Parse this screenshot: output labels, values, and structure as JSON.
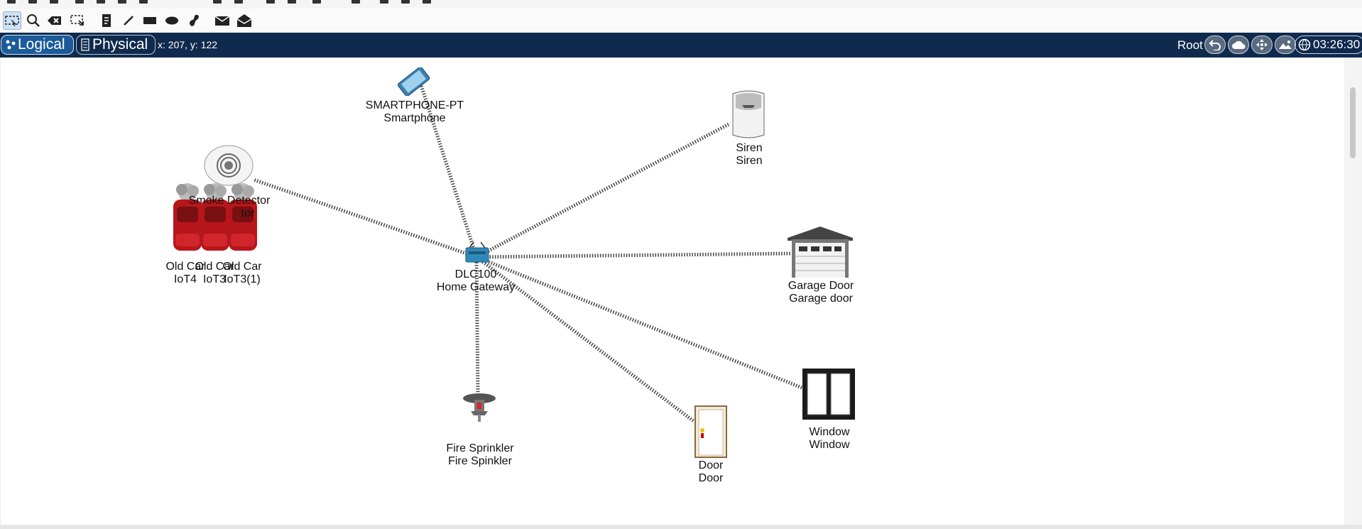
{
  "toolbar": {
    "tools": [
      "select-icon",
      "zoom-icon",
      "delete-icon",
      "resize-icon",
      "note-icon",
      "line-icon",
      "rectangle-icon",
      "ellipse-icon",
      "freeform-icon",
      "simple-pdu-icon",
      "complex-pdu-icon"
    ]
  },
  "navbar": {
    "tab_logical": "Logical",
    "tab_physical": "Physical",
    "coordinates": "x: 207, y: 122",
    "root_label": "Root",
    "time": "03:26:30"
  },
  "devices": {
    "smartphone": {
      "line1": "SMARTPHONE-PT",
      "line2": "Smartphone"
    },
    "siren": {
      "line1": "Siren",
      "line2": "Siren"
    },
    "smoke": {
      "line1": "Smoke Detector",
      "line2": "tor"
    },
    "car1": {
      "line1": "Old Car",
      "line2": "IoT4"
    },
    "car2": {
      "line1": "Old Car",
      "line2": "IoT3"
    },
    "car3": {
      "line1": "Old Car",
      "line2": "IoT3(1)"
    },
    "gateway": {
      "line1": "DLC100",
      "line2": "Home Gateway"
    },
    "garage": {
      "line1": "Garage Door",
      "line2": "Garage door"
    },
    "window": {
      "line1": "Window",
      "line2": "Window"
    },
    "sprinkler": {
      "line1": "Fire Sprinkler",
      "line2": "Fire Spinkler"
    },
    "door": {
      "line1": "Door",
      "line2": "Door"
    }
  },
  "colors": {
    "navbar": "#0f2a4d",
    "tab_active": "#1b5b9b",
    "link": "#444444"
  }
}
